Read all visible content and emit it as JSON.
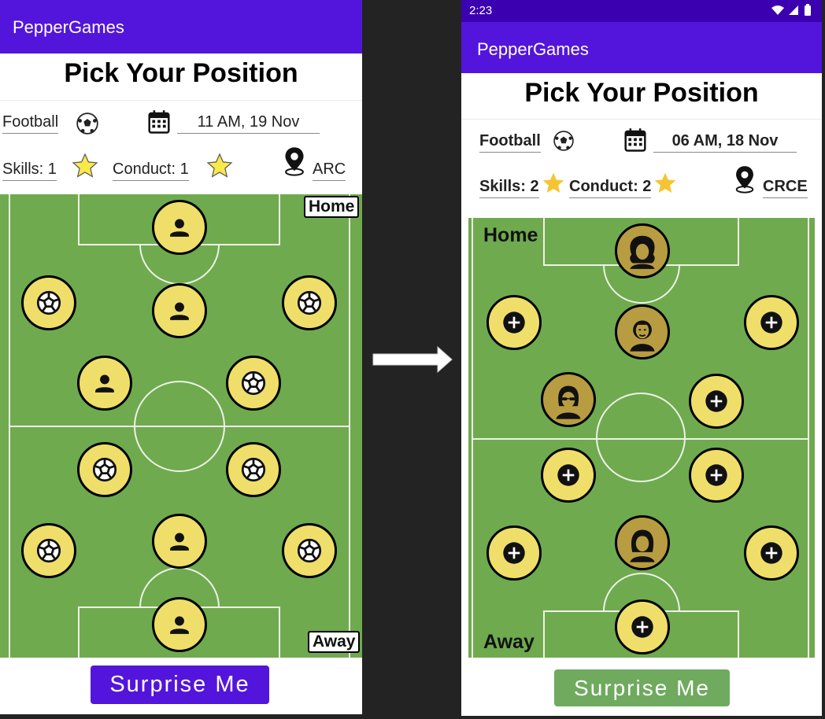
{
  "left_screen": {
    "app_title": "PepperGames",
    "heading": "Pick Your Position",
    "sport": "Football",
    "datetime": "11 AM, 19 Nov",
    "skills": "Skills: 1",
    "conduct": "Conduct: 1",
    "location": "ARC",
    "home_label": "Home",
    "away_label": "Away",
    "button": "Surprise Me",
    "accent": "#5315dc"
  },
  "right_screen": {
    "status_time": "2:23",
    "app_title": "PepperGames",
    "heading": "Pick Your Position",
    "sport": "Football",
    "datetime": "06 AM, 18 Nov",
    "skills": "Skills: 2",
    "conduct": "Conduct: 2",
    "location": "CRCE",
    "home_label": "Home",
    "away_label": "Away",
    "button": "Surprise Me",
    "button_color": "#6faa5f"
  },
  "colors": {
    "field": "#6faa4f",
    "slot": "#efdf6a",
    "taken": "#b89c41",
    "statusbar": "#3b00b0"
  },
  "icons": [
    "soccer-ball-icon",
    "calendar-icon",
    "star-icon",
    "location-pin-icon",
    "person-icon",
    "plus-icon",
    "right-arrow-icon"
  ]
}
